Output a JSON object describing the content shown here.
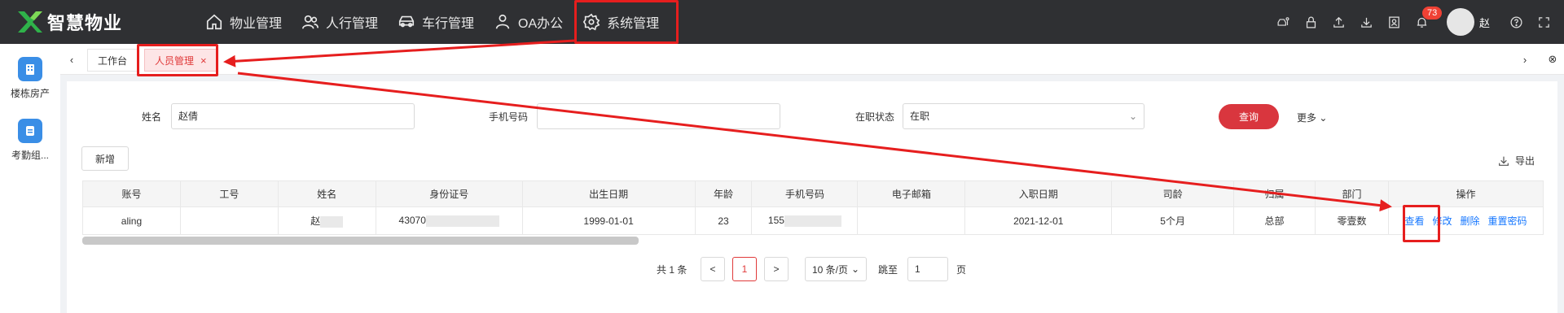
{
  "app": {
    "title": "智慧物业"
  },
  "nav": [
    {
      "label": "物业管理",
      "icon": "home-icon"
    },
    {
      "label": "人行管理",
      "icon": "people-icon"
    },
    {
      "label": "车行管理",
      "icon": "car-icon"
    },
    {
      "label": "OA办公",
      "icon": "person-icon"
    },
    {
      "label": "系统管理",
      "icon": "gear-icon"
    }
  ],
  "header": {
    "notification_count": "73",
    "user_name": "赵"
  },
  "sidebar": [
    {
      "label": "楼栋房产",
      "icon": "building-icon"
    },
    {
      "label": "考勤组...",
      "icon": "attendance-icon"
    }
  ],
  "tabs": [
    {
      "label": "工作台"
    },
    {
      "label": "人员管理",
      "close": "×"
    }
  ],
  "filters": {
    "name_label": "姓名",
    "name_value": "赵倩",
    "phone_label": "手机号码",
    "phone_value": "",
    "status_label": "在职状态",
    "status_value": "在职",
    "query_label": "查询",
    "more_label": "更多"
  },
  "toolbar": {
    "add_label": "新增",
    "export_label": "导出"
  },
  "table": {
    "columns": [
      "账号",
      "工号",
      "姓名",
      "身份证号",
      "出生日期",
      "年龄",
      "手机号码",
      "电子邮箱",
      "入职日期",
      "司龄",
      "归属",
      "部门",
      "操作"
    ],
    "row": {
      "account": "aling",
      "emp_no": "",
      "name": "赵",
      "id_no": "43070",
      "birth": "1999-01-01",
      "age": "23",
      "phone": "155",
      "email": "",
      "join_date": "2021-12-01",
      "tenure": "5个月",
      "belong": "总部",
      "dept": "零壹数"
    },
    "ops": [
      "查看",
      "修改",
      "删除",
      "重置密码"
    ]
  },
  "pagination": {
    "total": "共 1 条",
    "prev": "<",
    "current": "1",
    "next": ">",
    "page_size": "10 条/页",
    "jump_label": "跳至",
    "jump_value": "1",
    "page_unit": "页"
  },
  "annotation_color": "#e61e1e"
}
